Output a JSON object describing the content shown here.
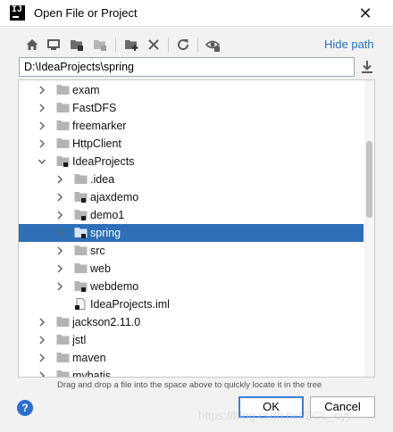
{
  "window": {
    "title": "Open File or Project",
    "app_icon_letters": "IJ",
    "close_glyph": "✕"
  },
  "toolbar": {
    "icons": [
      "home-icon",
      "desktop-icon",
      "project-folder-icon",
      "module-folder-icon",
      "new-folder-icon",
      "delete-icon",
      "refresh-icon",
      "show-hidden-icon"
    ],
    "hide_path_label": "Hide path"
  },
  "path": {
    "value": "D:\\IdeaProjects\\spring"
  },
  "tree": {
    "selected": "spring",
    "items": [
      {
        "label": "exam",
        "depth": 1,
        "expanded": false,
        "marked": false
      },
      {
        "label": "FastDFS",
        "depth": 1,
        "expanded": false,
        "marked": false
      },
      {
        "label": "freemarker",
        "depth": 1,
        "expanded": false,
        "marked": false
      },
      {
        "label": "HttpClient",
        "depth": 1,
        "expanded": false,
        "marked": false
      },
      {
        "label": "IdeaProjects",
        "depth": 1,
        "expanded": true,
        "marked": true
      },
      {
        "label": ".idea",
        "depth": 2,
        "expanded": false,
        "marked": false
      },
      {
        "label": "ajaxdemo",
        "depth": 2,
        "expanded": false,
        "marked": true
      },
      {
        "label": "demo1",
        "depth": 2,
        "expanded": false,
        "marked": true
      },
      {
        "label": "spring",
        "depth": 2,
        "expanded": false,
        "marked": true
      },
      {
        "label": "src",
        "depth": 2,
        "expanded": false,
        "marked": false
      },
      {
        "label": "web",
        "depth": 2,
        "expanded": false,
        "marked": false
      },
      {
        "label": "webdemo",
        "depth": 2,
        "expanded": false,
        "marked": true
      },
      {
        "label": "IdeaProjects.iml",
        "depth": 2,
        "file": true
      },
      {
        "label": "jackson2.11.0",
        "depth": 1,
        "expanded": false,
        "marked": false
      },
      {
        "label": "jstl",
        "depth": 1,
        "expanded": false,
        "marked": false
      },
      {
        "label": "maven",
        "depth": 1,
        "expanded": false,
        "marked": false
      },
      {
        "label": "mybatis",
        "depth": 1,
        "expanded": false,
        "marked": false
      }
    ]
  },
  "hint": "Drag and drop a file into the space above to quickly locate it in the tree",
  "buttons": {
    "help": "?",
    "ok": "OK",
    "cancel": "Cancel"
  },
  "watermark": "https://blog.csdn.net/ZGL_cyy",
  "colors": {
    "selection": "#2e6fb8",
    "link": "#2670c2",
    "ok_border": "#3b7ddd",
    "help": "#2d6fd0"
  }
}
